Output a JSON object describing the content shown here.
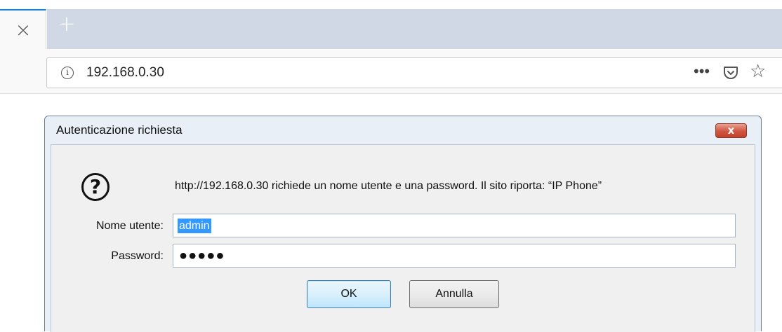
{
  "browser": {
    "tab_close_glyph": "×",
    "new_tab_glyph": "+",
    "url": "192.168.0.30",
    "info_glyph": "i",
    "more_glyph": "•••",
    "star_glyph": "☆"
  },
  "dialog": {
    "title": "Autenticazione richiesta",
    "close_glyph": "x",
    "icon_glyph": "?",
    "message": "http://192.168.0.30 richiede un nome utente e una password. Il sito riporta: “IP Phone”",
    "username_label": "Nome utente:",
    "username_value": "admin",
    "password_label": "Password:",
    "password_mask": "●●●●●",
    "ok_label": "OK",
    "cancel_label": "Annulla"
  },
  "colors": {
    "tab_accent": "#0a84ff",
    "tab_strip": "#cfd8e4",
    "dialog_frame": "#e9eff7",
    "selection": "#3399ff",
    "close_button": "#cf5540"
  },
  "icons": [
    "close-tab-icon",
    "new-tab-icon",
    "info-icon",
    "more-icon",
    "pocket-icon",
    "bookmark-star-icon",
    "question-icon",
    "dialog-close-icon"
  ]
}
